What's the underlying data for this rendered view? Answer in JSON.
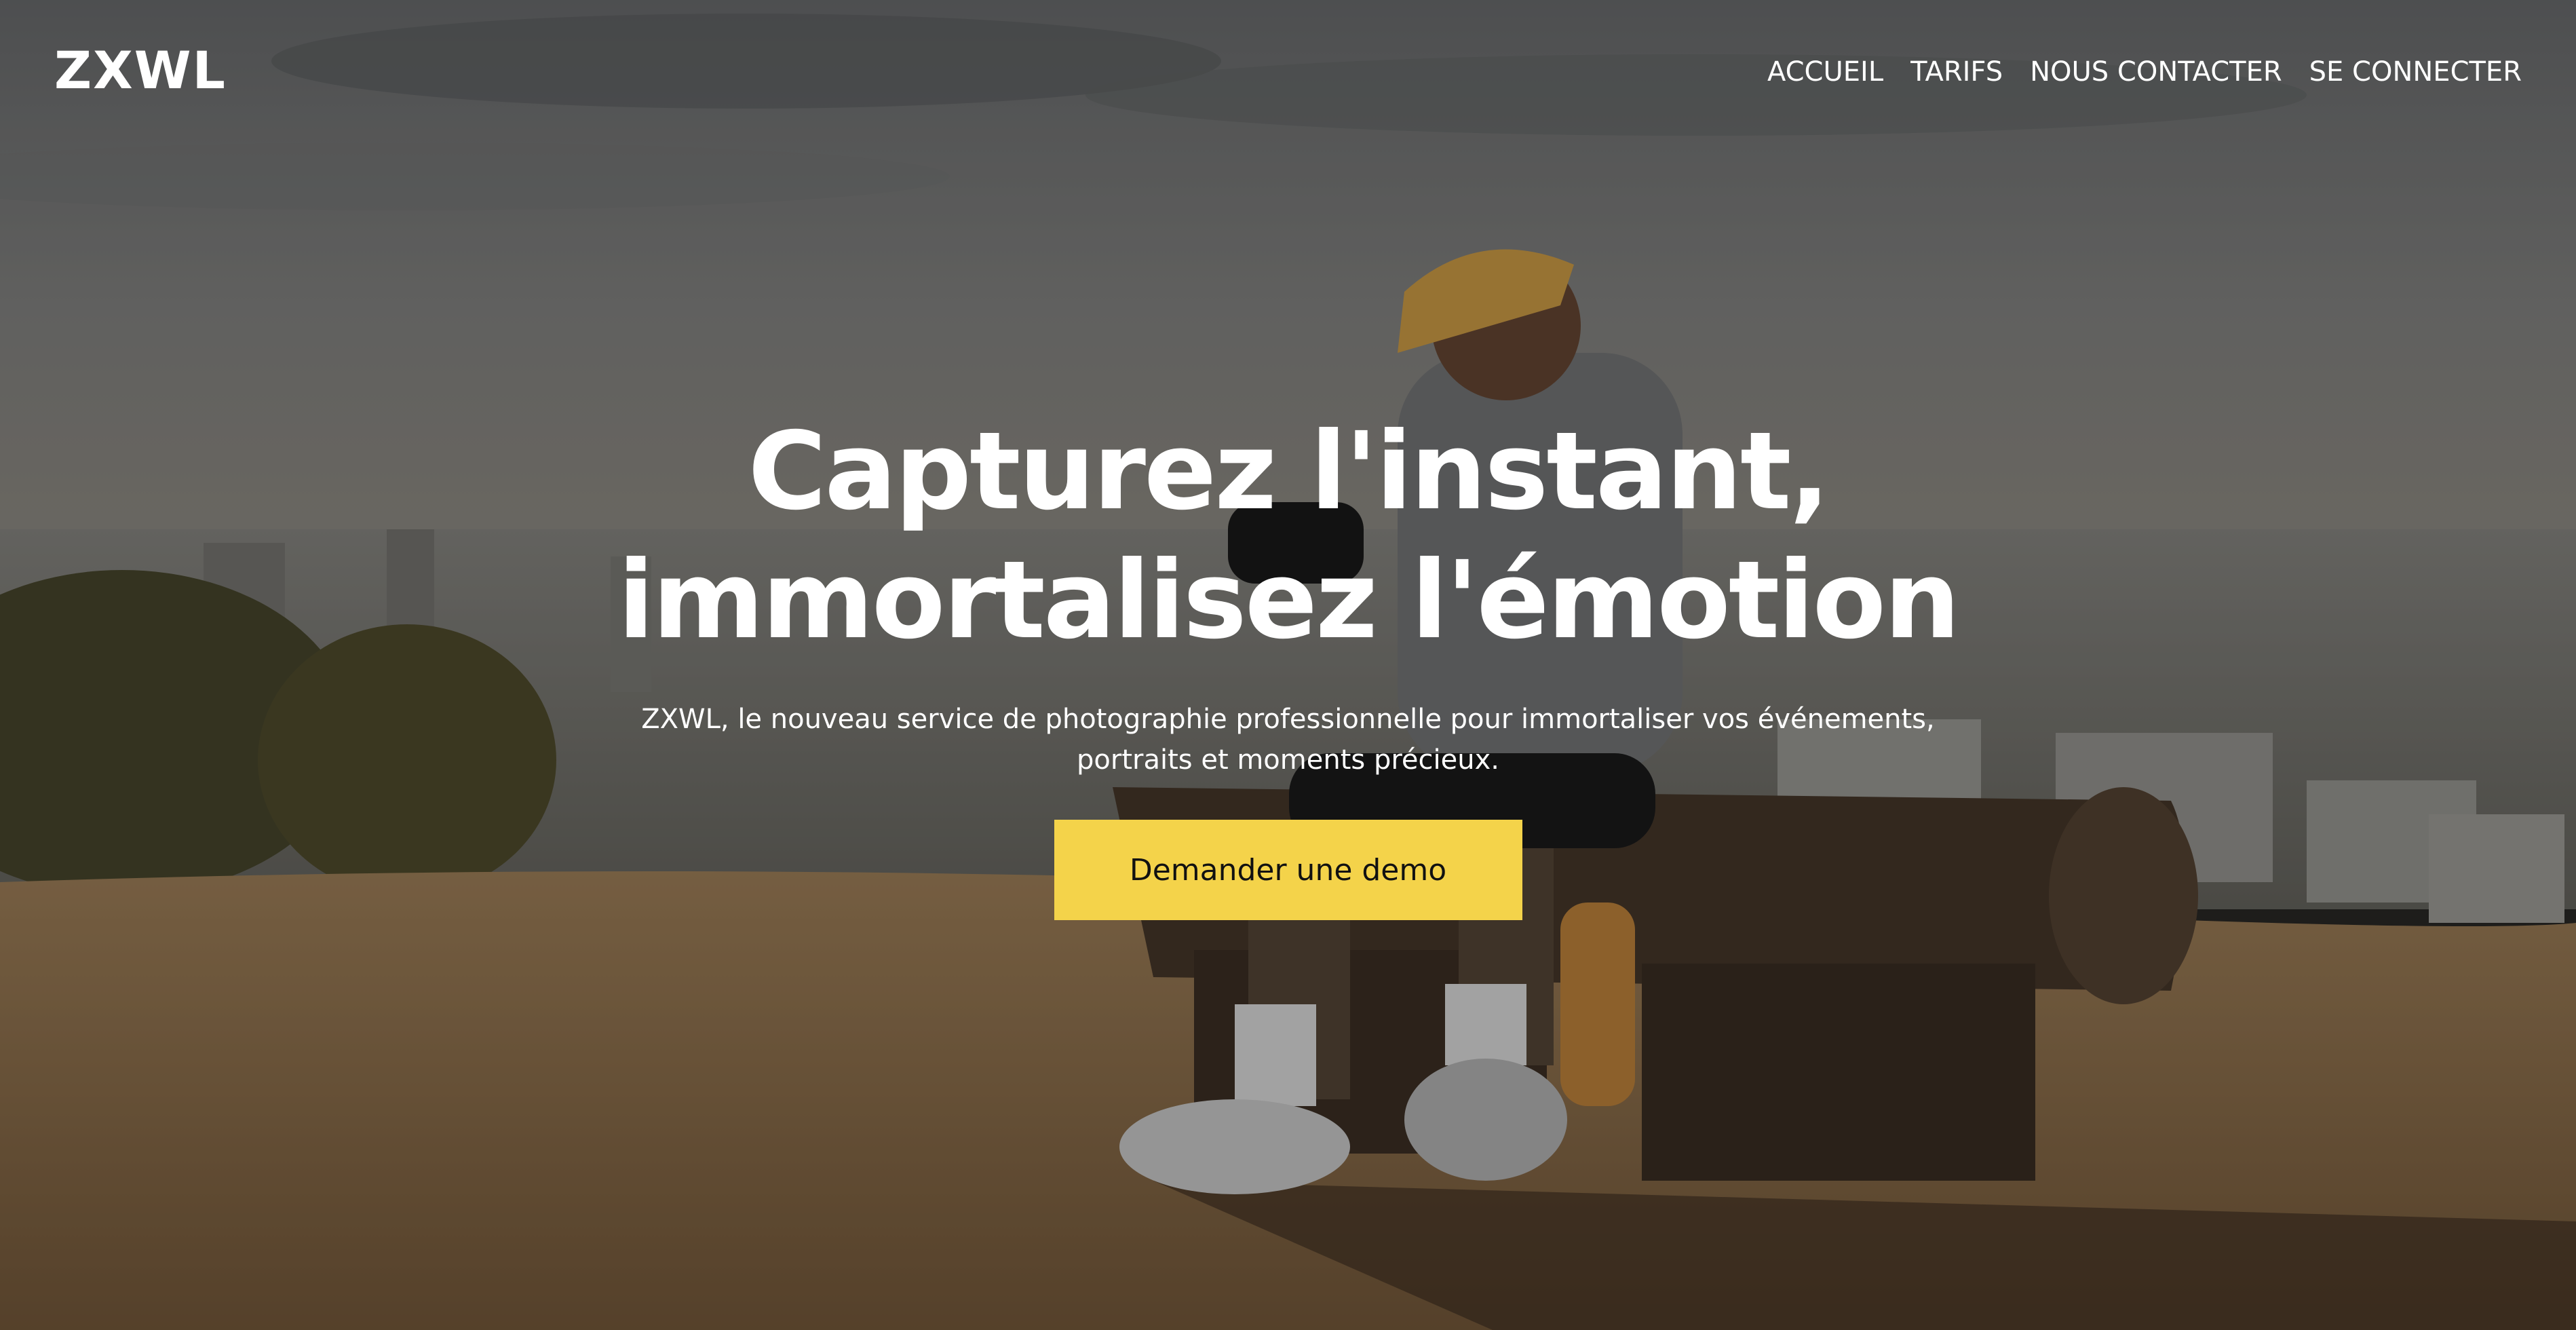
{
  "header": {
    "logo": "ZXWL",
    "nav": [
      {
        "label": "ACCUEIL"
      },
      {
        "label": "TARIFS"
      },
      {
        "label": "NOUS CONTACTER"
      },
      {
        "label": "SE CONNECTER"
      }
    ]
  },
  "hero": {
    "title_line1": "Capturez l'instant,",
    "title_line2": "immortalisez l'émotion",
    "subtitle_line1": "ZXWL, le nouveau service de photographie professionnelle pour immortaliser vos événements,",
    "subtitle_line2": "portraits et moments précieux.",
    "cta_label": "Demander une demo"
  },
  "colors": {
    "accent": "#f4d34a",
    "text": "#ffffff",
    "button_text": "#111111"
  }
}
